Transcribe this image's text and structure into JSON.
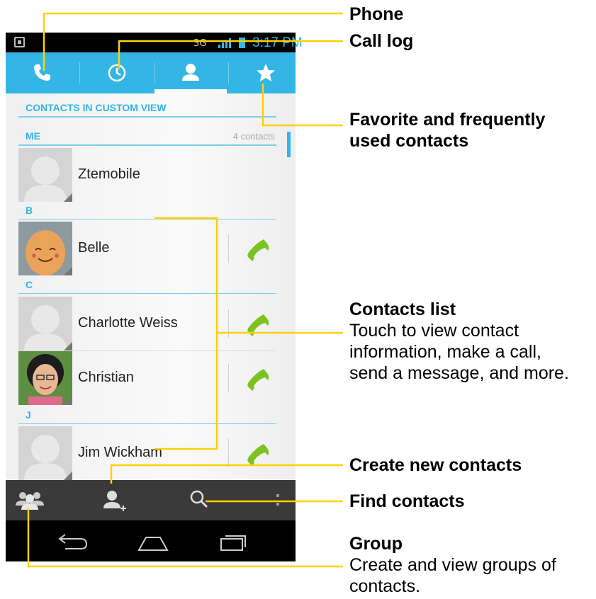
{
  "status_bar": {
    "network": "3G",
    "time": "3:17 PM"
  },
  "tabs": [
    {
      "id": "phone",
      "icon": "phone-icon"
    },
    {
      "id": "call-log",
      "icon": "clock-icon"
    },
    {
      "id": "contacts",
      "icon": "person-icon",
      "selected": true
    },
    {
      "id": "favorites",
      "icon": "star-icon"
    }
  ],
  "contacts": {
    "header": "CONTACTS IN CUSTOM VIEW",
    "me_label": "ME",
    "count": "4 contacts",
    "me_name": "Ztemobile",
    "sections": [
      {
        "letter": "B",
        "items": [
          {
            "name": "Belle"
          }
        ]
      },
      {
        "letter": "C",
        "items": [
          {
            "name": "Charlotte Weiss"
          },
          {
            "name": "Christian"
          }
        ]
      },
      {
        "letter": "J",
        "items": [
          {
            "name": "Jim Wickham"
          }
        ]
      }
    ]
  },
  "action_bar": [
    "group-icon",
    "add-contact-icon",
    "search-icon",
    "overflow-menu-icon"
  ],
  "nav_bar": [
    "back-icon",
    "home-icon",
    "recent-apps-icon"
  ],
  "callouts": {
    "phone": {
      "title": "Phone"
    },
    "call_log": {
      "title": "Call log"
    },
    "favorites": {
      "title_line1": "Favorite and frequently",
      "title_line2": "used contacts"
    },
    "contacts_list": {
      "title": "Contacts list",
      "desc_line1": "Touch to view contact",
      "desc_line2": "information, make a call,",
      "desc_line3": "send a message, and more."
    },
    "create": {
      "title": "Create new contacts"
    },
    "find": {
      "title": "Find contacts"
    },
    "group": {
      "title": "Group",
      "desc_line1": "Create and view groups of",
      "desc_line2": "contacts."
    }
  },
  "colors": {
    "accent": "#33b5e5",
    "callout_line": "#ffd200",
    "call_green": "#7cc220",
    "action_bar": "#3a3a3a"
  }
}
